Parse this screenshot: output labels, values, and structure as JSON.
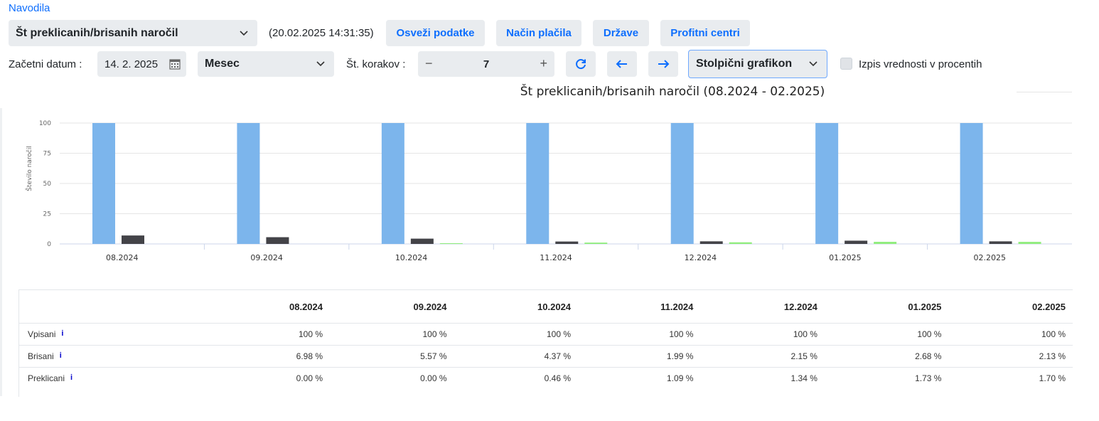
{
  "header": {
    "instructions_link": "Navodila",
    "report_select": "Št preklicanih/brisanih naročil",
    "timestamp": "(20.02.2025 14:31:35)",
    "buttons": {
      "refresh_data": "Osveži podatke",
      "payment_method": "Način plačila",
      "countries": "Države",
      "profit_centers": "Profitni centri"
    }
  },
  "controls": {
    "start_date_label": "Začetni datum :",
    "start_date_value": "14. 2. 2025",
    "period_select": "Mesec",
    "steps_label": "Št. korakov :",
    "steps_value": "7",
    "minus": "−",
    "plus": "+",
    "chart_type_select": "Stolpični grafikon",
    "percent_checkbox_label": "Izpis vrednosti v procentih"
  },
  "colors": {
    "vpisani": "#7cb5ec",
    "brisani": "#434348",
    "preklicani": "#90ed7d",
    "accent": "#0d6efd"
  },
  "chart_data": {
    "type": "bar",
    "title": "Št preklicanih/brisanih naročil (08.2024 - 02.2025)",
    "ylabel": "Število naročil",
    "ylim": [
      0,
      100
    ],
    "yticks": [
      0,
      25,
      50,
      75,
      100
    ],
    "grid": true,
    "categories": [
      "08.2024",
      "09.2024",
      "10.2024",
      "11.2024",
      "12.2024",
      "01.2025",
      "02.2025"
    ],
    "series": [
      {
        "name": "Vpisani",
        "values": [
          100,
          100,
          100,
          100,
          100,
          100,
          100
        ]
      },
      {
        "name": "Brisani",
        "values": [
          6.98,
          5.57,
          4.37,
          1.99,
          2.15,
          2.68,
          2.13
        ]
      },
      {
        "name": "Preklicani",
        "values": [
          0.0,
          0.0,
          0.46,
          1.09,
          1.34,
          1.73,
          1.7
        ]
      }
    ]
  },
  "table": {
    "headers": [
      "08.2024",
      "09.2024",
      "10.2024",
      "11.2024",
      "12.2024",
      "01.2025",
      "02.2025"
    ],
    "info_glyph": "i",
    "rows": [
      {
        "label": "Vpisani",
        "values": [
          "100 %",
          "100 %",
          "100 %",
          "100 %",
          "100 %",
          "100 %",
          "100 %"
        ]
      },
      {
        "label": "Brisani",
        "values": [
          "6.98 %",
          "5.57 %",
          "4.37 %",
          "1.99 %",
          "2.15 %",
          "2.68 %",
          "2.13 %"
        ]
      },
      {
        "label": "Preklicani",
        "values": [
          "0.00 %",
          "0.00 %",
          "0.46 %",
          "1.09 %",
          "1.34 %",
          "1.73 %",
          "1.70 %"
        ]
      }
    ]
  }
}
